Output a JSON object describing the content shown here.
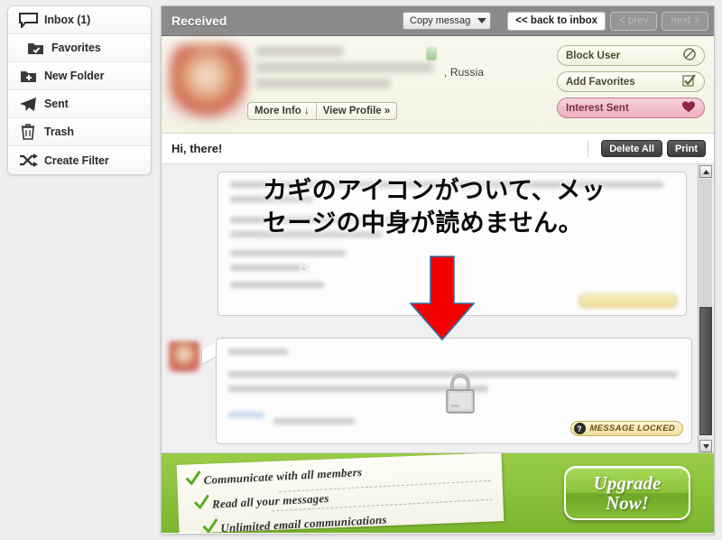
{
  "sidebar": {
    "items": [
      {
        "label": "Inbox (1)",
        "icon": "speech-bubble-icon"
      },
      {
        "label": "Favorites",
        "icon": "folder-check-icon"
      },
      {
        "label": "New Folder",
        "icon": "folder-plus-icon"
      },
      {
        "label": "Sent",
        "icon": "paper-plane-icon"
      },
      {
        "label": "Trash",
        "icon": "trash-can-icon"
      },
      {
        "label": "Create Filter",
        "icon": "shuffle-arrows-icon"
      }
    ]
  },
  "topbar": {
    "title": "Received",
    "dropdown_value": "Copy messag",
    "back_to_inbox": "<< back to inbox",
    "prev": "< prev",
    "next": "next >"
  },
  "profile": {
    "country": ", Russia",
    "more_info": "More Info ↓",
    "view_profile": "View Profile »",
    "block_user": "Block User",
    "add_favorites": "Add Favorites",
    "interest_sent": "Interest Sent"
  },
  "message_header": {
    "subject": "Hi, there!",
    "delete_all": "Delete All",
    "print": "Print"
  },
  "thread": {
    "watermark": "BLOND-LOVE.COM",
    "locked_badge": "MESSAGE LOCKED",
    "locked_badge_icon": "question-mark-icon",
    "lock_icon": "padlock-icon",
    "arrow_icon": "red-down-arrow-icon"
  },
  "annotation": {
    "japanese_text": "カギのアイコンがついて、メッ\nセージの中身が読めません。"
  },
  "banner": {
    "bullets": [
      "Communicate with all members",
      "Read all your messages",
      "Unlimited email communications"
    ],
    "upgrade_line1": "Upgrade",
    "upgrade_line2": "Now!"
  },
  "colors": {
    "topbar_gray": "#8b8b8b",
    "banner_green": "#8cc33c",
    "arrow_red": "#f40000",
    "badge_yellow": "#efdf9d",
    "interest_pink": "#edaebd"
  }
}
